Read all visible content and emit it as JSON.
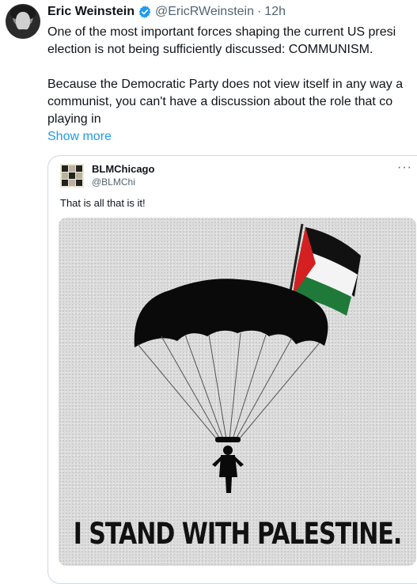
{
  "tweet": {
    "author_name": "Eric Weinstein",
    "author_handle": "@EricRWeinstein",
    "separator": "·",
    "time": "12h",
    "verified_icon": "verified-badge-icon",
    "text_lines": [
      "One of the most important forces shaping the current US presi",
      "election is not being sufficiently discussed: COMMUNISM."
    ],
    "text_lines_2": [
      "Because the Democratic Party does not view itself in any way a",
      "communist, you can't have a discussion about the role that co",
      "playing in"
    ],
    "show_more": "Show more"
  },
  "quoted_tweet": {
    "author_name": "BLMChicago",
    "author_handle": "@BLMChi",
    "more_icon": "more-options-icon",
    "text": "That is all that is it!",
    "image": {
      "caption": "I STAND WITH PALESTINE.",
      "depicts": [
        "parachute-icon",
        "palestine-flag-icon",
        "parachutist-silhouette-icon"
      ]
    }
  },
  "colors": {
    "link": "#1d9bf0",
    "secondary_text": "#536471",
    "verified": "#1d9bf0",
    "border": "#cfd9de"
  }
}
